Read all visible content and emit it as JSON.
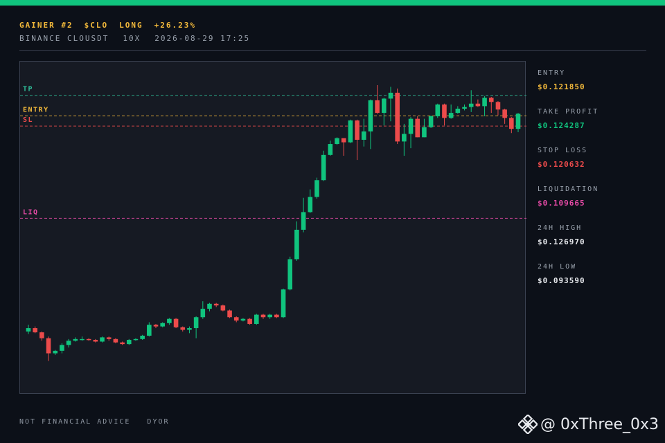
{
  "header": {
    "tag": "GAINER #2",
    "symbol": "$CLO",
    "side": "LONG",
    "change": "+26.23%",
    "exchange": "BINANCE CLOUSDT",
    "leverage": "10X",
    "datetime": "2026-08-29 17:25"
  },
  "stats": [
    {
      "label": "ENTRY",
      "value": "$0.121850",
      "color": "#f2b93b"
    },
    {
      "label": "TAKE PROFIT",
      "value": "$0.124287",
      "color": "#10c47e"
    },
    {
      "label": "STOP LOSS",
      "value": "$0.120632",
      "color": "#ec4b4b"
    },
    {
      "label": "LIQUIDATION",
      "value": "$0.109665",
      "color": "#e64aa6"
    },
    {
      "label": "24H HIGH",
      "value": "$0.126970",
      "color": "#e6e8ec"
    },
    {
      "label": "24H LOW",
      "value": "$0.093590",
      "color": "#e6e8ec"
    }
  ],
  "footer": {
    "disclaimer": "NOT FINANCIAL ADVICE",
    "dyor": "DYOR"
  },
  "watermark": {
    "handle": "@ 0xThree_0x3",
    "icon": "binance-logo-icon"
  },
  "colors": {
    "up": "#10c47e",
    "down": "#ec4b4b",
    "tp": "#2fbf9a",
    "entry": "#f2b93b",
    "sl": "#ec4b4b",
    "liq": "#e64aa6"
  },
  "chart_data": {
    "type": "candlestick",
    "levels": [
      {
        "name": "TP",
        "price": 0.124287,
        "color": "#2fbf9a"
      },
      {
        "name": "ENTRY",
        "price": 0.12185,
        "color": "#f2b93b"
      },
      {
        "name": "SL",
        "price": 0.120632,
        "color": "#ec4b4b"
      },
      {
        "name": "LIQ",
        "price": 0.109665,
        "color": "#e64aa6"
      }
    ],
    "ylim": [
      0.0887,
      0.1283
    ],
    "candles": [
      [
        0.0962,
        0.0966,
        0.0959,
        0.097
      ],
      [
        0.0966,
        0.0961,
        0.096,
        0.0968
      ],
      [
        0.0961,
        0.0954,
        0.0951,
        0.0962
      ],
      [
        0.0954,
        0.0936,
        0.0927,
        0.0956
      ],
      [
        0.0936,
        0.0939,
        0.0934,
        0.094
      ],
      [
        0.0939,
        0.0946,
        0.0936,
        0.0948
      ],
      [
        0.0946,
        0.0951,
        0.0943,
        0.0953
      ],
      [
        0.0951,
        0.0953,
        0.095,
        0.0955
      ],
      [
        0.0953,
        0.0953,
        0.0951,
        0.0956
      ],
      [
        0.0953,
        0.0952,
        0.0951,
        0.0954
      ],
      [
        0.0952,
        0.095,
        0.0949,
        0.0953
      ],
      [
        0.095,
        0.0955,
        0.0949,
        0.0956
      ],
      [
        0.0955,
        0.0953,
        0.0951,
        0.0956
      ],
      [
        0.0953,
        0.0949,
        0.0948,
        0.0954
      ],
      [
        0.0949,
        0.0947,
        0.0946,
        0.095
      ],
      [
        0.0947,
        0.0952,
        0.0946,
        0.0953
      ],
      [
        0.0952,
        0.0953,
        0.0951,
        0.0954
      ],
      [
        0.0953,
        0.0957,
        0.0952,
        0.0958
      ],
      [
        0.0957,
        0.097,
        0.0956,
        0.0973
      ],
      [
        0.097,
        0.0968,
        0.0966,
        0.0971
      ],
      [
        0.0968,
        0.0972,
        0.0967,
        0.0973
      ],
      [
        0.0972,
        0.0977,
        0.097,
        0.0978
      ],
      [
        0.0977,
        0.0967,
        0.0966,
        0.0978
      ],
      [
        0.0967,
        0.0964,
        0.0962,
        0.0968
      ],
      [
        0.0964,
        0.0966,
        0.096,
        0.0968
      ],
      [
        0.0966,
        0.0979,
        0.0954,
        0.098
      ],
      [
        0.0979,
        0.0989,
        0.0977,
        0.0998
      ],
      [
        0.0989,
        0.0995,
        0.0986,
        0.0996
      ],
      [
        0.0995,
        0.0993,
        0.0991,
        0.0996
      ],
      [
        0.0993,
        0.0987,
        0.0986,
        0.0994
      ],
      [
        0.0987,
        0.0979,
        0.0978,
        0.0988
      ],
      [
        0.0979,
        0.0975,
        0.0973,
        0.098
      ],
      [
        0.0975,
        0.0977,
        0.0974,
        0.0978
      ],
      [
        0.0977,
        0.0971,
        0.097,
        0.0978
      ],
      [
        0.0971,
        0.0982,
        0.097,
        0.0983
      ],
      [
        0.0982,
        0.0979,
        0.0977,
        0.0983
      ],
      [
        0.0979,
        0.0982,
        0.0977,
        0.0983
      ],
      [
        0.0982,
        0.0979,
        0.0978,
        0.0983
      ],
      [
        0.0979,
        0.1012,
        0.0978,
        0.1013
      ],
      [
        0.1012,
        0.1048,
        0.1011,
        0.1051
      ],
      [
        0.1048,
        0.1083,
        0.1046,
        0.1093
      ],
      [
        0.1083,
        0.1104,
        0.108,
        0.1121
      ],
      [
        0.1104,
        0.1122,
        0.1103,
        0.1131
      ],
      [
        0.1122,
        0.1142,
        0.112,
        0.1145
      ],
      [
        0.1142,
        0.1172,
        0.1141,
        0.1177
      ],
      [
        0.1172,
        0.1185,
        0.1171,
        0.1189
      ],
      [
        0.1185,
        0.1192,
        0.1184,
        0.1193
      ],
      [
        0.1192,
        0.1187,
        0.1171,
        0.1191
      ],
      [
        0.1187,
        0.1213,
        0.1186,
        0.1214
      ],
      [
        0.1213,
        0.119,
        0.1166,
        0.1214
      ],
      [
        0.119,
        0.12,
        0.1182,
        0.1215
      ],
      [
        0.12,
        0.1237,
        0.1179,
        0.1238
      ],
      [
        0.1237,
        0.1222,
        0.1221,
        0.1255
      ],
      [
        0.1222,
        0.1239,
        0.1207,
        0.124
      ],
      [
        0.1239,
        0.1246,
        0.1212,
        0.1253
      ],
      [
        0.1246,
        0.1188,
        0.1185,
        0.1251
      ],
      [
        0.1188,
        0.1197,
        0.1171,
        0.1209
      ],
      [
        0.1197,
        0.1215,
        0.118,
        0.1217
      ],
      [
        0.1215,
        0.1193,
        0.1193,
        0.1218
      ],
      [
        0.1193,
        0.1205,
        0.1193,
        0.1215
      ],
      [
        0.1205,
        0.1218,
        0.1204,
        0.1219
      ],
      [
        0.1218,
        0.1232,
        0.1216,
        0.1233
      ],
      [
        0.1232,
        0.1216,
        0.1207,
        0.1233
      ],
      [
        0.1216,
        0.1222,
        0.1215,
        0.1232
      ],
      [
        0.1222,
        0.1227,
        0.1221,
        0.123
      ],
      [
        0.1227,
        0.1229,
        0.1225,
        0.1232
      ],
      [
        0.1229,
        0.1233,
        0.1223,
        0.1249
      ],
      [
        0.1233,
        0.123,
        0.1229,
        0.1238
      ],
      [
        0.123,
        0.124,
        0.1218,
        0.1242
      ],
      [
        0.124,
        0.1235,
        0.1222,
        0.1241
      ],
      [
        0.1235,
        0.1226,
        0.1219,
        0.1236
      ],
      [
        0.1226,
        0.1216,
        0.1209,
        0.1227
      ],
      [
        0.1216,
        0.1203,
        0.1198,
        0.1217
      ],
      [
        0.1203,
        0.1221,
        0.1199,
        0.1222
      ]
    ]
  }
}
